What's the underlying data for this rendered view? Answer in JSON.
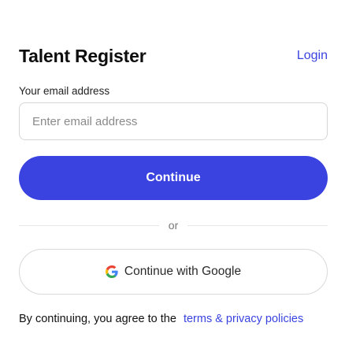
{
  "header": {
    "title": "Talent Register",
    "login_label": "Login"
  },
  "email": {
    "label": "Your email address",
    "placeholder": "Enter email address",
    "value": ""
  },
  "continue_button": {
    "label": "Continue"
  },
  "divider": {
    "text": "or"
  },
  "google_button": {
    "label": "Continue with Google",
    "icon": "google-icon"
  },
  "terms": {
    "prefix": "By continuing, you agree to the",
    "link_label": "terms & privacy policies"
  },
  "colors": {
    "accent": "#3a43e0",
    "border": "#d6d6d6",
    "text": "#111111"
  }
}
